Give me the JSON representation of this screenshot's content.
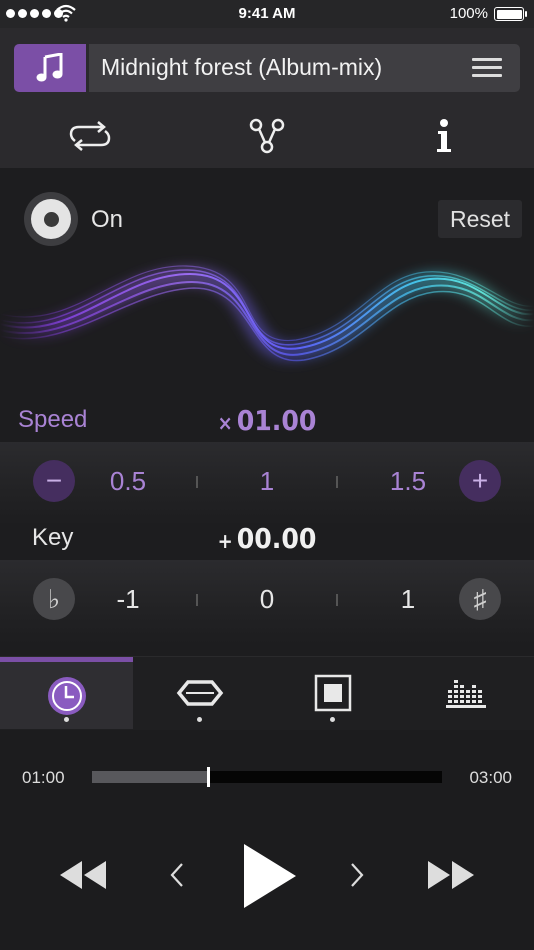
{
  "status_bar": {
    "time": "9:41 AM",
    "battery": "100%"
  },
  "header": {
    "track_title": "Midnight forest (Album-mix)"
  },
  "effect": {
    "toggle_label": "On",
    "reset_label": "Reset",
    "speed": {
      "label": "Speed",
      "prefix": "×",
      "value": "01.00",
      "minus": "−",
      "plus": "+",
      "ticks": [
        "0.5",
        "1",
        "1.5"
      ]
    },
    "key": {
      "label": "Key",
      "prefix": "+",
      "value": "00.00",
      "flat": "♭",
      "sharp": "♯",
      "ticks": [
        "-1",
        "0",
        "1"
      ]
    }
  },
  "player": {
    "elapsed": "01:00",
    "total": "03:00",
    "progress_fraction": 0.33
  },
  "colors": {
    "accent": "#7b4fa6",
    "accent_light": "#a983d4"
  }
}
